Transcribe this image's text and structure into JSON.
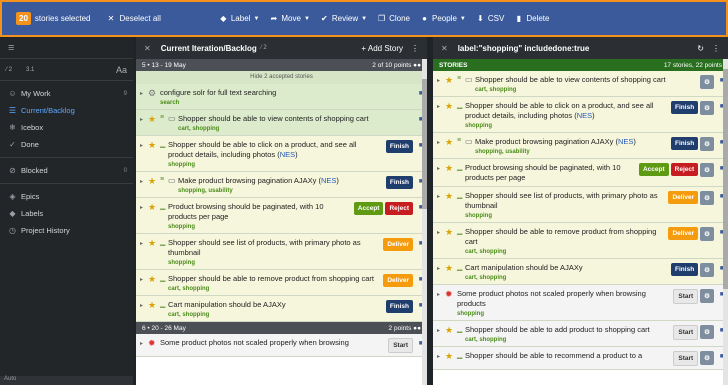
{
  "selection": {
    "count": "20",
    "label": "stories selected",
    "deselect": "Deselect all",
    "actions": [
      {
        "label": "Label",
        "icon": "tag-icon"
      },
      {
        "label": "Move",
        "icon": "move-icon"
      },
      {
        "label": "Review",
        "icon": "review-icon"
      },
      {
        "label": "Clone",
        "icon": "clone-icon"
      },
      {
        "label": "People",
        "icon": "people-icon"
      },
      {
        "label": "CSV",
        "icon": "download-icon"
      },
      {
        "label": "Delete",
        "icon": "delete-icon"
      }
    ]
  },
  "sidebar": {
    "toolbar_left_a": "2",
    "toolbar_left_b": "3.1",
    "toolbar_right": "Aa",
    "items": [
      {
        "label": "My Work",
        "count": "9",
        "icon": "person-icon"
      },
      {
        "label": "Current/Backlog",
        "count": "",
        "icon": "backlog-icon"
      },
      {
        "label": "Icebox",
        "count": "",
        "icon": "icebox-icon"
      },
      {
        "label": "Done",
        "count": "",
        "icon": "check-icon"
      },
      {
        "label": "Blocked",
        "count": "0",
        "icon": "blocked-icon"
      },
      {
        "label": "Epics",
        "count": "",
        "icon": "epics-icon"
      },
      {
        "label": "Labels",
        "count": "",
        "icon": "label-icon"
      },
      {
        "label": "Project History",
        "count": "",
        "icon": "history-icon"
      }
    ],
    "footer": "Auto"
  },
  "backlog": {
    "title": "Current Iteration/Backlog",
    "meta": "2",
    "add": "Add Story",
    "iteration1": {
      "label": "5 • 13 - 19 May",
      "points": "2 of 10 points"
    },
    "hide_accepted": "Hide 2 accepted stories",
    "stories": [
      {
        "title": "configure solr for full text searching",
        "labels": "search",
        "state": "accepted",
        "kind": "chore",
        "btn": ""
      },
      {
        "title": "Shopper should be able to view contents of shopping cart",
        "labels": "cart, shopping",
        "state": "accepted",
        "kind": "feature",
        "btn": ""
      },
      {
        "title_a": "Shopper should be able to click on a product, and see all product details, including photos (",
        "link": "NES",
        "title_b": ")",
        "labels": "shopping",
        "state": "pending",
        "kind": "feature",
        "btn": "Finish"
      },
      {
        "title_a": "Make product browsing pagination AJAXy (",
        "link": "NES",
        "title_b": ")",
        "labels": "shopping, usability",
        "state": "pending",
        "kind": "feature",
        "btn": "Finish"
      },
      {
        "title": "Product browsing should be paginated, with 10 products per page",
        "labels": "shopping",
        "state": "pending",
        "kind": "feature",
        "btn1": "Accept",
        "btn2": "Reject"
      },
      {
        "title": "Shopper should see list of products, with primary photo as thumbnail",
        "labels": "shopping",
        "state": "pending",
        "kind": "feature",
        "btn": "Deliver"
      },
      {
        "title": "Shopper should be able to remove product from shopping cart",
        "labels": "cart, shopping",
        "state": "pending",
        "kind": "feature",
        "btn": "Deliver"
      },
      {
        "title": "Cart manipulation should be AJAXy",
        "labels": "cart, shopping",
        "state": "pending",
        "kind": "feature",
        "btn": "Finish"
      }
    ],
    "iteration2": {
      "label": "6 • 20 - 26 May",
      "points": "2 points"
    },
    "last_story": {
      "title": "Some product photos not scaled properly when browsing",
      "btn": "Start"
    }
  },
  "search": {
    "title": "label:\"shopping\" includedone:true",
    "header_left": "STORIES",
    "header_right": "17 stories, 22 points",
    "stories": [
      {
        "title": "Shopper should be able to view contents of shopping cart",
        "labels": "cart, shopping",
        "btn": ""
      },
      {
        "title_a": "Shopper should be able to click on a product, and see all product details, including photos (",
        "link": "NES",
        "title_b": ")",
        "labels": "shopping",
        "btn": "Finish"
      },
      {
        "title_a": "Make product browsing pagination AJAXy (",
        "link": "NES",
        "title_b": ")",
        "labels": "shopping, usability",
        "btn": "Finish"
      },
      {
        "title": "Product browsing should be paginated, with 10 products per page",
        "labels": "",
        "btn1": "Accept",
        "btn2": "Reject"
      },
      {
        "title": "Shopper should see list of products, with primary photo as thumbnail",
        "labels": "shopping",
        "btn": "Deliver"
      },
      {
        "title": "Shopper should be able to remove product from shopping cart",
        "labels": "cart, shopping",
        "btn": "Deliver"
      },
      {
        "title": "Cart manipulation should be AJAXy",
        "labels": "cart, shopping",
        "btn": "Finish"
      },
      {
        "title": "Some product photos not scaled properly when browsing products",
        "labels": "shopping",
        "btn": "Start"
      },
      {
        "title": "Shopper should be able to add product to shopping cart",
        "labels": "cart, shopping",
        "btn": "Start"
      },
      {
        "title": "Shopper should be able to recommend a product to a",
        "labels": "",
        "btn": "Start"
      }
    ]
  }
}
